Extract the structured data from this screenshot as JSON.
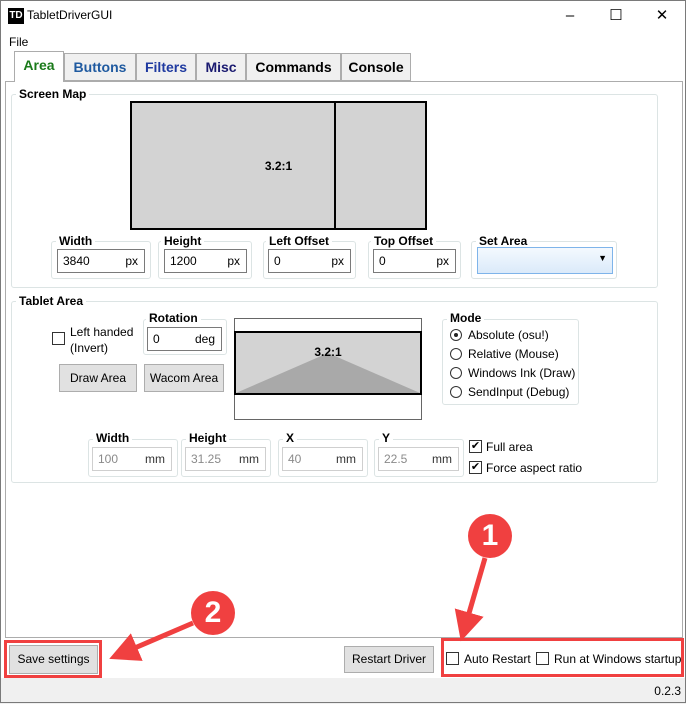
{
  "window": {
    "title": "TabletDriverGUI",
    "logo": "TD",
    "minimize": "–",
    "maximize": "☐",
    "close": "✕"
  },
  "menu": {
    "file": "File"
  },
  "tabs": [
    {
      "label": "Area",
      "color": "#1a7a1a"
    },
    {
      "label": "Buttons",
      "color": "#1f5aa0"
    },
    {
      "label": "Filters",
      "color": "#1f3aa0"
    },
    {
      "label": "Misc",
      "color": "#1a1a70"
    },
    {
      "label": "Commands",
      "color": "#000000"
    },
    {
      "label": "Console",
      "color": "#000000"
    }
  ],
  "screen_map": {
    "label": "Screen Map",
    "ratio": "3.2:1",
    "width": {
      "label": "Width",
      "value": "3840",
      "unit": "px"
    },
    "height": {
      "label": "Height",
      "value": "1200",
      "unit": "px"
    },
    "left_offset": {
      "label": "Left Offset",
      "value": "0",
      "unit": "px"
    },
    "top_offset": {
      "label": "Top Offset",
      "value": "0",
      "unit": "px"
    },
    "set_area": {
      "label": "Set Area",
      "value": ""
    }
  },
  "tablet_area": {
    "label": "Tablet Area",
    "ratio": "3.2:1",
    "left_handed": {
      "label1": "Left handed",
      "label2": "(Invert)",
      "checked": false
    },
    "rotation": {
      "label": "Rotation",
      "value": "0",
      "unit": "deg"
    },
    "draw_area": "Draw Area",
    "wacom_area": "Wacom Area",
    "mode": {
      "label": "Mode",
      "options": [
        "Absolute (osu!)",
        "Relative (Mouse)",
        "Windows Ink (Draw)",
        "SendInput (Debug)"
      ],
      "selected": "Absolute (osu!)"
    },
    "width": {
      "label": "Width",
      "value": "100",
      "unit": "mm"
    },
    "height": {
      "label": "Height",
      "value": "31.25",
      "unit": "mm"
    },
    "x": {
      "label": "X",
      "value": "40",
      "unit": "mm"
    },
    "y": {
      "label": "Y",
      "value": "22.5",
      "unit": "mm"
    },
    "full_area": {
      "label": "Full area",
      "checked": true
    },
    "force_aspect": {
      "label": "Force aspect ratio",
      "checked": true
    }
  },
  "bottom": {
    "save": "Save settings",
    "restart": "Restart Driver",
    "auto_restart": "Auto Restart",
    "run_startup": "Run at Windows startup"
  },
  "status": {
    "version": "0.2.3"
  },
  "annotations": {
    "one": "1",
    "two": "2",
    "color": "#f04040"
  }
}
